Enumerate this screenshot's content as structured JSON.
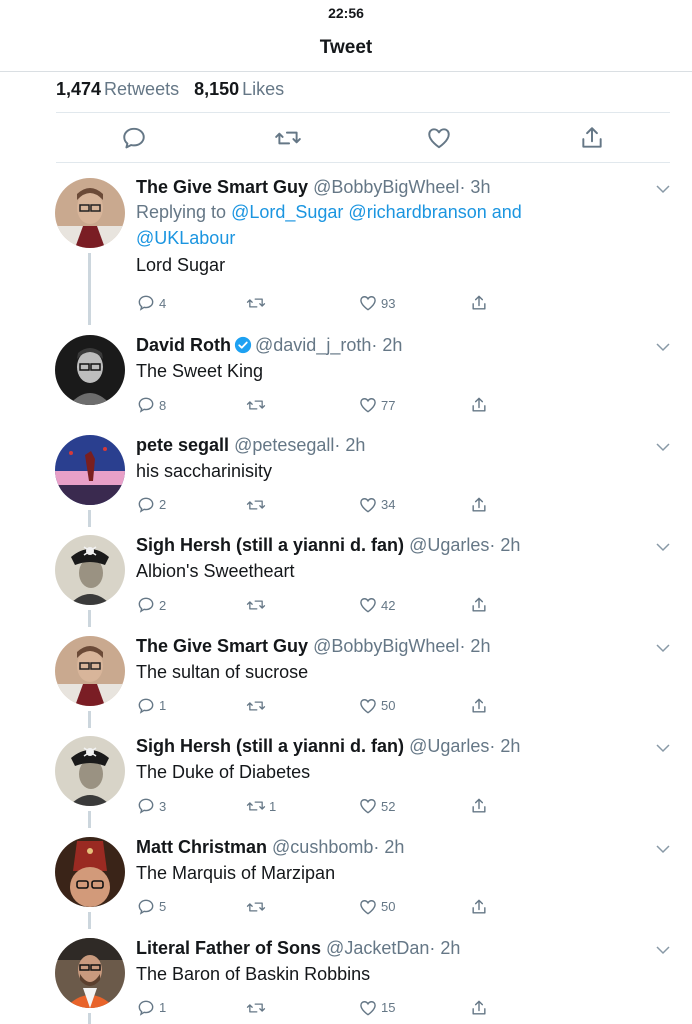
{
  "status_bar": {
    "time": "22:56"
  },
  "nav": {
    "title": "Tweet"
  },
  "stats": {
    "retweets_count": "1,474",
    "retweets_label": "Retweets",
    "likes_count": "8,150",
    "likes_label": "Likes"
  },
  "colors": {
    "accent": "#1b95e0",
    "muted": "#657786",
    "text": "#14171a",
    "divider": "#e1e8ed"
  },
  "replies": [
    {
      "name": "The Give Smart Guy",
      "handle": "@BobbyBigWheel",
      "time": "· 3h",
      "replying_prefix": "Replying to",
      "replying_mentions": "@Lord_Sugar @richardbranson and",
      "replying_mentions2": "@UKLabour",
      "text": "Lord Sugar",
      "reply_count": "4",
      "retweet_count": "",
      "like_count": "93",
      "avatar_icon": "avatar-bobby"
    },
    {
      "name": "David Roth",
      "handle": "@david_j_roth",
      "time": "· 2h",
      "verified": true,
      "text": "The Sweet King",
      "reply_count": "8",
      "retweet_count": "",
      "like_count": "77",
      "avatar_icon": "avatar-david"
    },
    {
      "name": "pete segall",
      "handle": "@petesegall",
      "time": "· 2h",
      "text": "his saccharinisity",
      "reply_count": "2",
      "retweet_count": "",
      "like_count": "34",
      "avatar_icon": "avatar-pete"
    },
    {
      "name": "Sigh Hersh (still a yianni d. fan)",
      "handle": "@Ugarles",
      "time": "· 2h",
      "text": "Albion's Sweetheart",
      "reply_count": "2",
      "retweet_count": "",
      "like_count": "42",
      "avatar_icon": "avatar-sigh"
    },
    {
      "name": "The Give Smart Guy",
      "handle": "@BobbyBigWheel",
      "time": "· 2h",
      "text": "The sultan of sucrose",
      "reply_count": "1",
      "retweet_count": "",
      "like_count": "50",
      "avatar_icon": "avatar-bobby"
    },
    {
      "name": "Sigh Hersh (still a yianni d. fan)",
      "handle": "@Ugarles",
      "time": "· 2h",
      "text": "The Duke of Diabetes",
      "reply_count": "3",
      "retweet_count": "1",
      "like_count": "52",
      "avatar_icon": "avatar-sigh"
    },
    {
      "name": "Matt Christman",
      "handle": "@cushbomb",
      "time": "· 2h",
      "text": "The Marquis of Marzipan",
      "reply_count": "5",
      "retweet_count": "",
      "like_count": "50",
      "avatar_icon": "avatar-matt"
    },
    {
      "name": "Literal Father of Sons",
      "handle": "@JacketDan",
      "time": "· 2h",
      "text": "The Baron of Baskin Robbins",
      "reply_count": "1",
      "retweet_count": "",
      "like_count": "15",
      "avatar_icon": "avatar-jacket"
    }
  ]
}
